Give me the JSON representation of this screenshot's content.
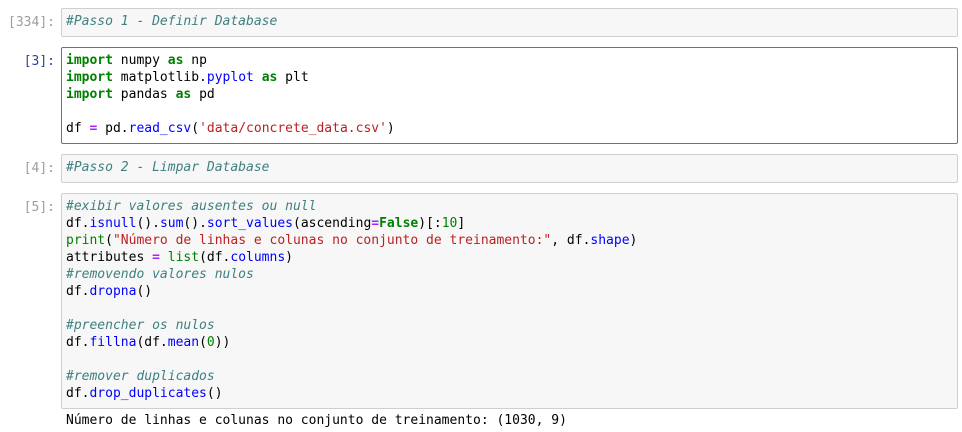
{
  "cells": [
    {
      "prompt": "[334]:",
      "lines": [
        "#Passo 1 - Definir Database"
      ]
    },
    {
      "prompt": "[3]:",
      "lines": [
        "import numpy as np",
        "import matplotlib.pyplot as plt",
        "import pandas as pd",
        "",
        "df = pd.read_csv('data/concrete_data.csv')"
      ]
    },
    {
      "prompt": "[4]:",
      "lines": [
        "#Passo 2 - Limpar Database"
      ]
    },
    {
      "prompt": "[5]:",
      "lines": [
        "#exibir valores ausentes ou null",
        "df.isnull().sum().sort_values(ascending=False)[:10]",
        "print(\"Número de linhas e colunas no conjunto de treinamento:\", df.shape)",
        "attributes = list(df.columns)",
        "#removendo valores nulos",
        "df.dropna()",
        "",
        "#preencher os nulos",
        "df.fillna(df.mean(0))",
        "",
        "#remover duplicados",
        "df.drop_duplicates()"
      ],
      "output": "Número de linhas e colunas no conjunto de treinamento: (1030, 9)"
    }
  ],
  "colors": {
    "keyword": "#008000",
    "comment": "#408080",
    "string": "#ba2121",
    "operator": "#aa22ff",
    "attribute": "#0000ff",
    "selected_border": "#1e88e5",
    "prompt": "#9e9e9e",
    "prompt_active": "#303f9f"
  }
}
